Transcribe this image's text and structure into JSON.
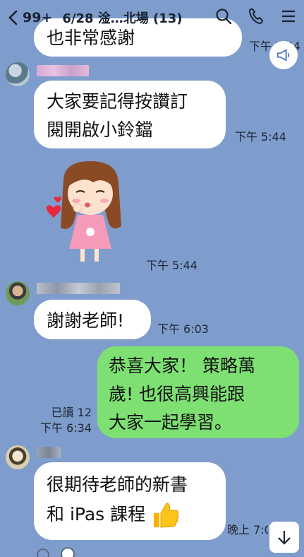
{
  "header": {
    "unread_count": "99+",
    "chat_title": "6/28 淦…北場 (13)"
  },
  "messages": [
    {
      "text": "也非常感謝",
      "time": "下午 5:44"
    },
    {
      "text_line1": "大家要記得按讚訂",
      "text_line2": "閱開啟小鈴鐺",
      "time": "下午 5:44"
    },
    {
      "time": "下午 5:44"
    },
    {
      "text": "謝謝老師!",
      "time": "下午 6:03"
    },
    {
      "text_line1": "恭喜大家！ 策略萬",
      "text_line2": "歲! 也很高興能跟",
      "text_line3": "大家一起學習。",
      "read": "已讀 12",
      "time": "下午 6:34"
    },
    {
      "text_line1": "很期待老師的新書",
      "text_line2": "和 iPas 課程",
      "time": "晚上 7:0"
    }
  ],
  "colors": {
    "background": "#7f9dcc",
    "incoming_bubble": "#ffffff",
    "outgoing_bubble": "#7ee073"
  }
}
